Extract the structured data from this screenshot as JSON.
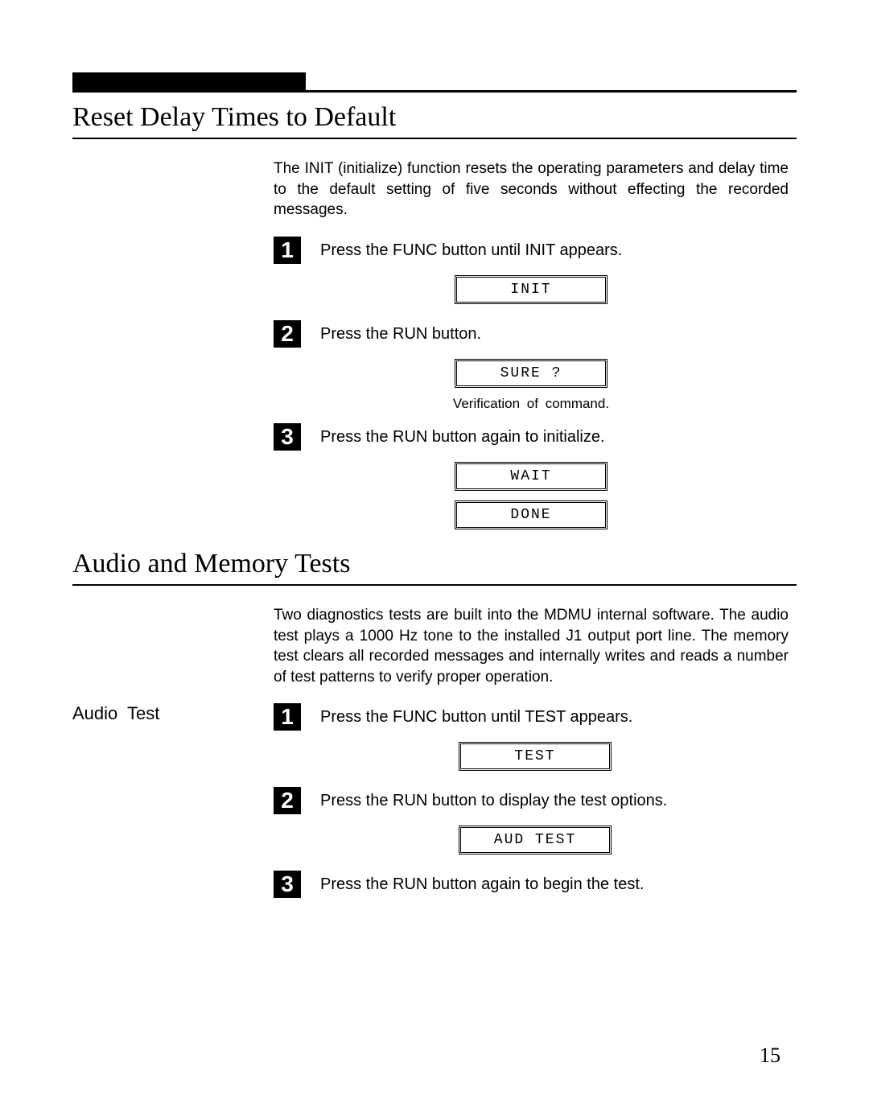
{
  "section1": {
    "title": "Reset Delay Times to Default",
    "intro": "The INIT (initialize) function resets the operating parameters and delay time to the default setting of five seconds without effecting the recorded messages.",
    "steps": [
      {
        "num": "1",
        "text": "Press the FUNC button until INIT appears."
      },
      {
        "num": "2",
        "text": "Press the RUN button."
      },
      {
        "num": "3",
        "text": "Press the RUN button again to initialize."
      }
    ],
    "lcd": {
      "init": "INIT",
      "sure": "SURE ?",
      "wait": "WAIT",
      "done": "DONE"
    },
    "caption_verify": "Verification  of  command."
  },
  "section2": {
    "title": "Audio and Memory Tests",
    "intro": "Two diagnostics tests are built into the MDMU internal software. The audio test plays a 1000 Hz tone to the installed J1 output port line. The memory test  clears all recorded messages and internally writes and reads a number of test patterns to verify proper operation.",
    "subhead": "Audio  Test",
    "steps": [
      {
        "num": "1",
        "text": "Press the FUNC button until TEST appears."
      },
      {
        "num": "2",
        "text": "Press the RUN button to display the test options."
      },
      {
        "num": "3",
        "text": "Press the RUN button again to begin the test."
      }
    ],
    "lcd": {
      "test": "TEST",
      "aud": "AUD TEST"
    }
  },
  "page_number": "15"
}
